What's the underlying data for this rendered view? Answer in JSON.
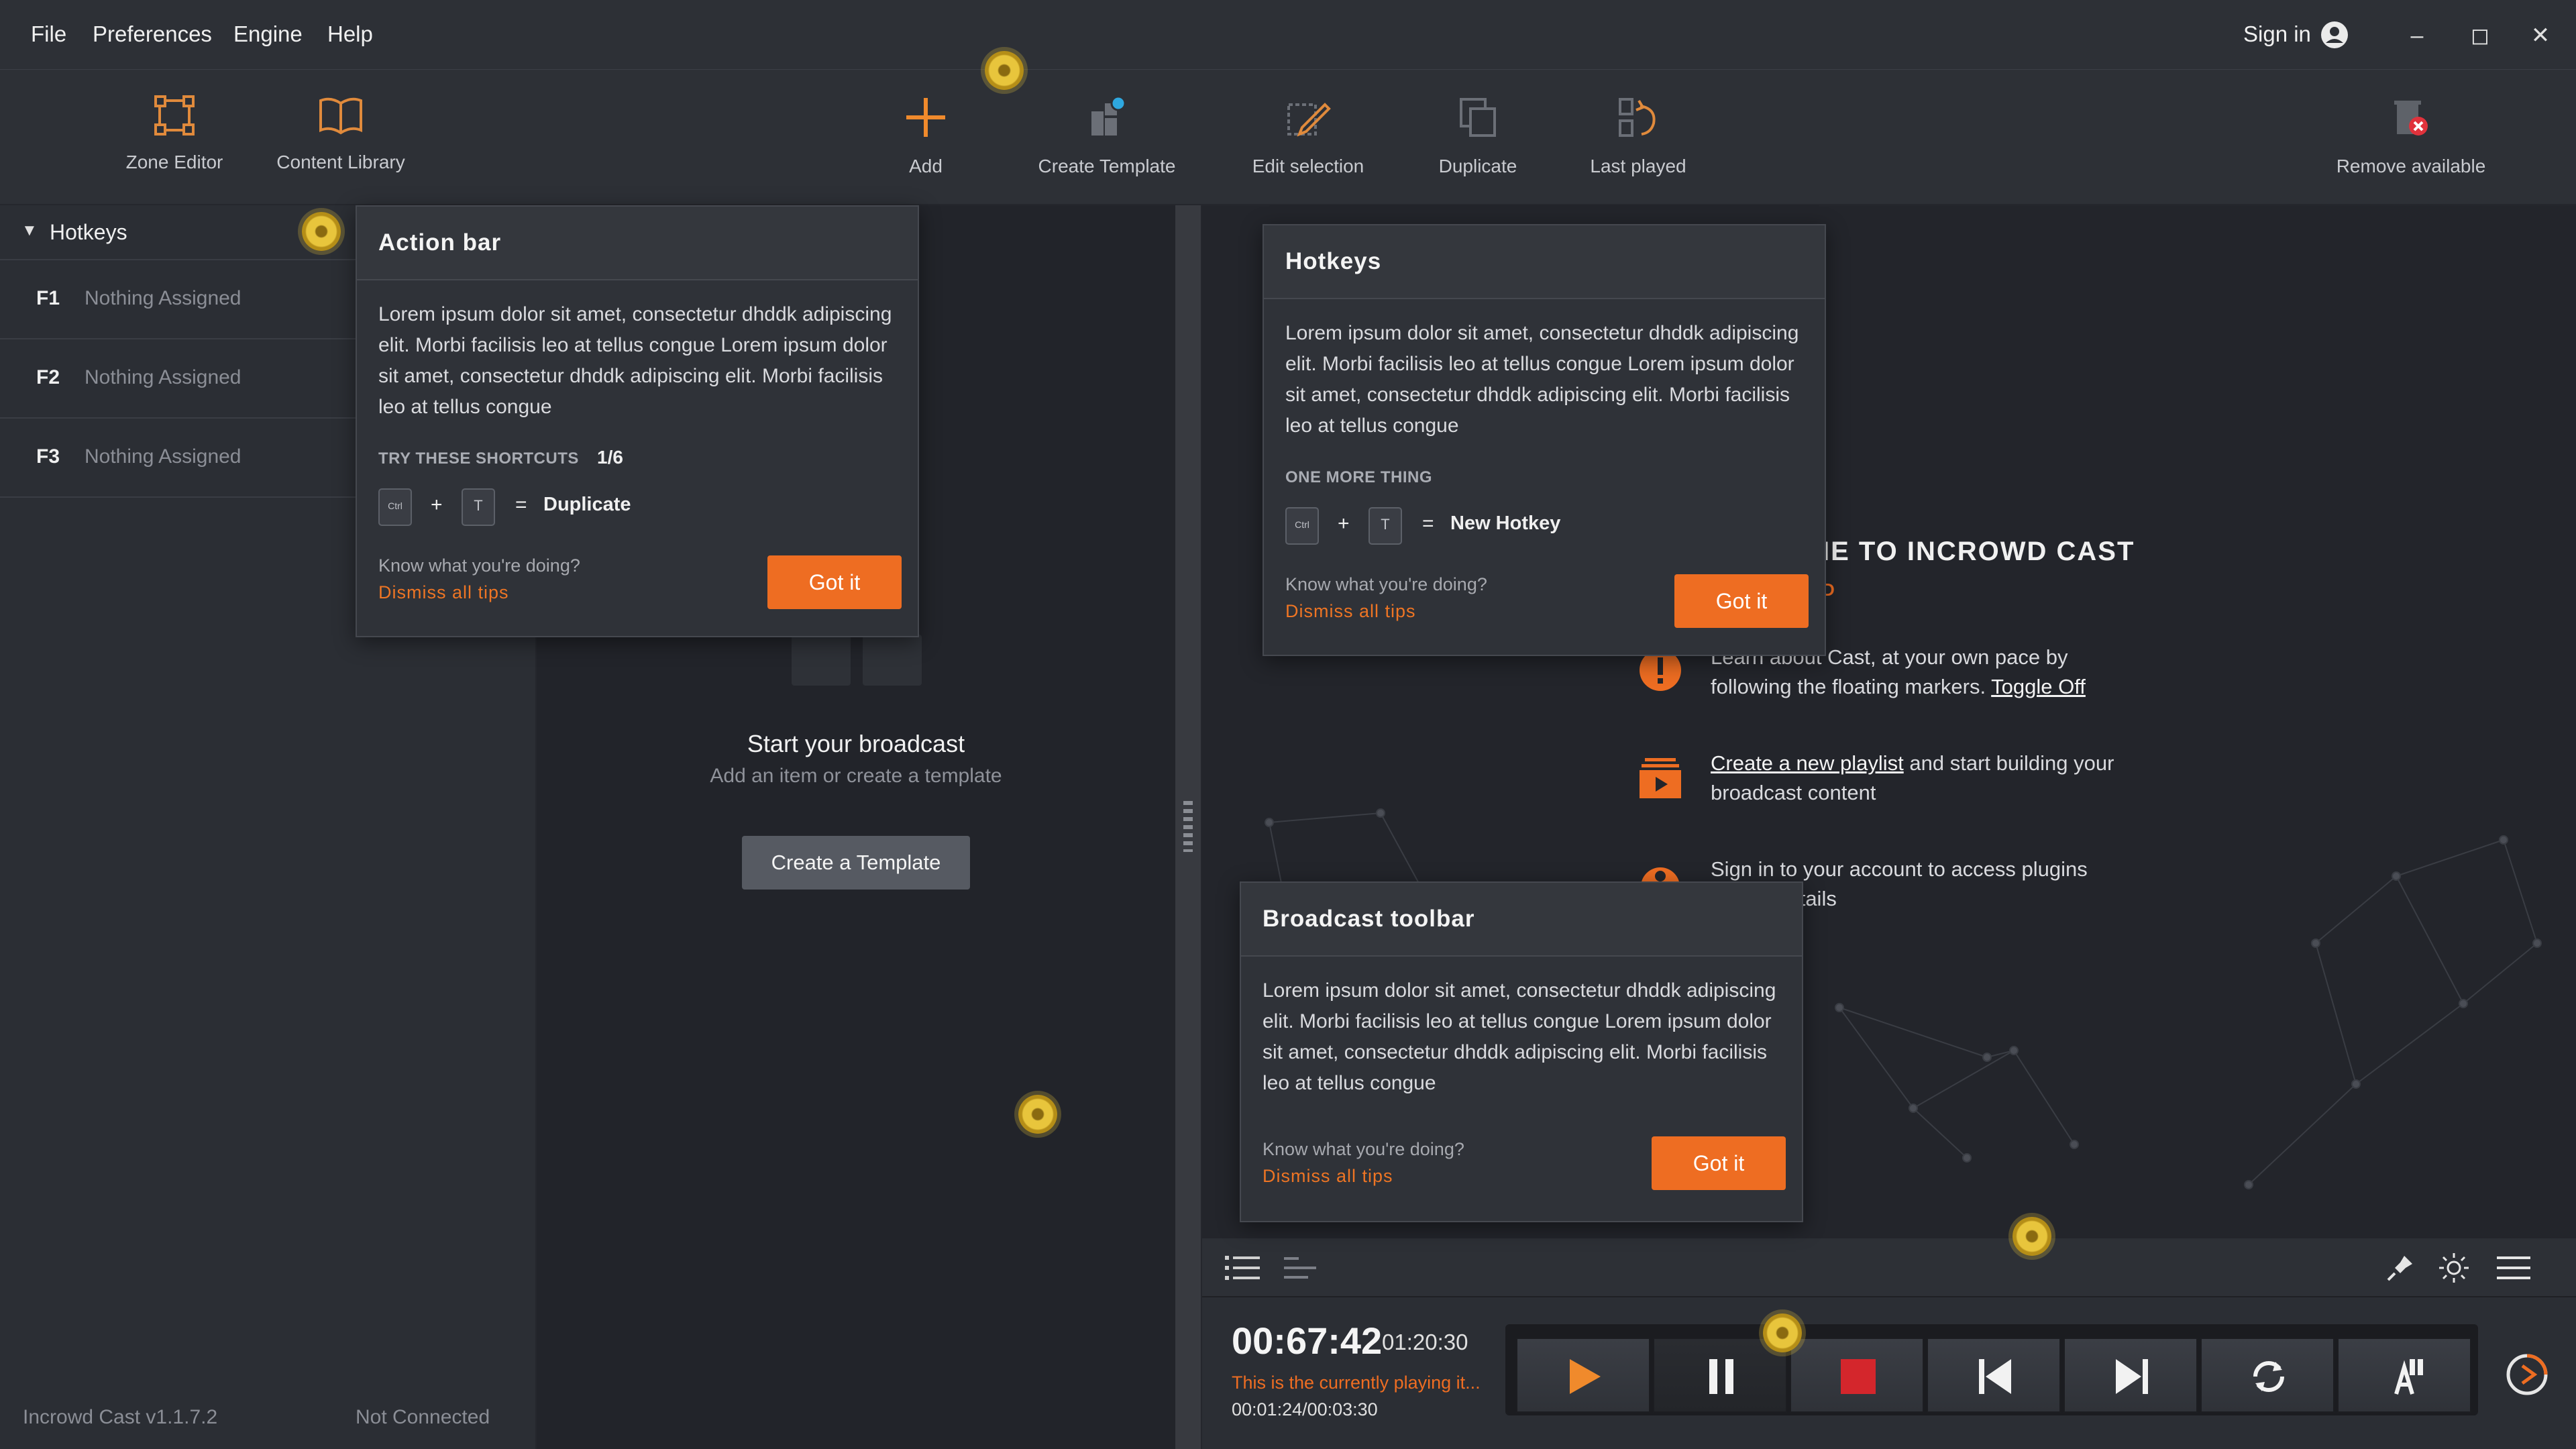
{
  "menu": {
    "file": "File",
    "preferences": "Preferences",
    "engine": "Engine",
    "help": "Help",
    "sign_in": "Sign in"
  },
  "toolbar": {
    "zone_editor": "Zone Editor",
    "content_library": "Content Library",
    "add": "Add",
    "create_template": "Create Template",
    "edit_selection": "Edit selection",
    "duplicate": "Duplicate",
    "last_played": "Last played",
    "remove_available": "Remove available"
  },
  "sidebar": {
    "title": "Hotkeys",
    "items": [
      {
        "key": "F1",
        "value": "Nothing Assigned"
      },
      {
        "key": "F2",
        "value": "Nothing Assigned"
      },
      {
        "key": "F3",
        "value": "Nothing Assigned"
      }
    ],
    "version": "Incrowd Cast v1.1.7.2",
    "connection": "Not Connected"
  },
  "center": {
    "title": "Start your broadcast",
    "subtitle": "Add an item or create a template",
    "button": "Create a Template"
  },
  "welcome": {
    "title": "IE TO INCROWD CAST",
    "subtitle": "D",
    "item1_prefix": "Learn about Cast, at your own pace by",
    "item1_line2": "following the floating markers.",
    "item1_link": "Toggle Off",
    "item2_link": "Create a new playlist",
    "item2_text": "and  start building your",
    "item2_line2": "broadcast content",
    "item3_line1": "Sign in to your account to access plugins",
    "item3_line2": "icence details"
  },
  "tip_action": {
    "title": "Action bar",
    "body": "Lorem ipsum dolor sit amet, consectetur dhddk adipiscing elit. Morbi facilisis leo at tellus congue Lorem ipsum dolor sit amet, consectetur dhddk adipiscing elit. Morbi facilisis leo at tellus congue",
    "shortcut_label": "TRY THESE SHORTCUTS",
    "counter": "1/6",
    "key1": "Ctrl",
    "key2": "T",
    "plus": "+",
    "equals": "=",
    "result": "Duplicate",
    "know": "Know what you're doing?",
    "dismiss": "Dismiss all tips",
    "button": "Got it"
  },
  "tip_hotkeys": {
    "title": "Hotkeys",
    "body": "Lorem ipsum dolor sit amet, consectetur dhddk adipiscing elit. Morbi facilisis leo at tellus congue Lorem ipsum dolor sit amet, consectetur dhddk adipiscing elit. Morbi facilisis leo at tellus congue",
    "shortcut_label": "ONE MORE THING",
    "key1": "Ctrl",
    "key2": "T",
    "plus": "+",
    "equals": "=",
    "result": "New Hotkey",
    "know": "Know what you're doing?",
    "dismiss": "Dismiss all tips",
    "button": "Got it"
  },
  "tip_broadcast": {
    "title": "Broadcast toolbar",
    "body": "Lorem ipsum dolor sit amet, consectetur dhddk adipiscing elit. Morbi facilisis leo at tellus congue Lorem ipsum dolor sit amet, consectetur dhddk adipiscing elit. Morbi facilisis leo at tellus congue",
    "know": "Know what you're doing?",
    "dismiss": "Dismiss all tips",
    "button": "Got it"
  },
  "player": {
    "elapsed": "00:67:42",
    "total": "01:20:30",
    "now_playing": "This is the currently playing it...",
    "position": "00:01:24/00:03:30"
  },
  "colors": {
    "accent": "#ee6d22",
    "marker": "#e8c53c",
    "background": "#25272d"
  }
}
